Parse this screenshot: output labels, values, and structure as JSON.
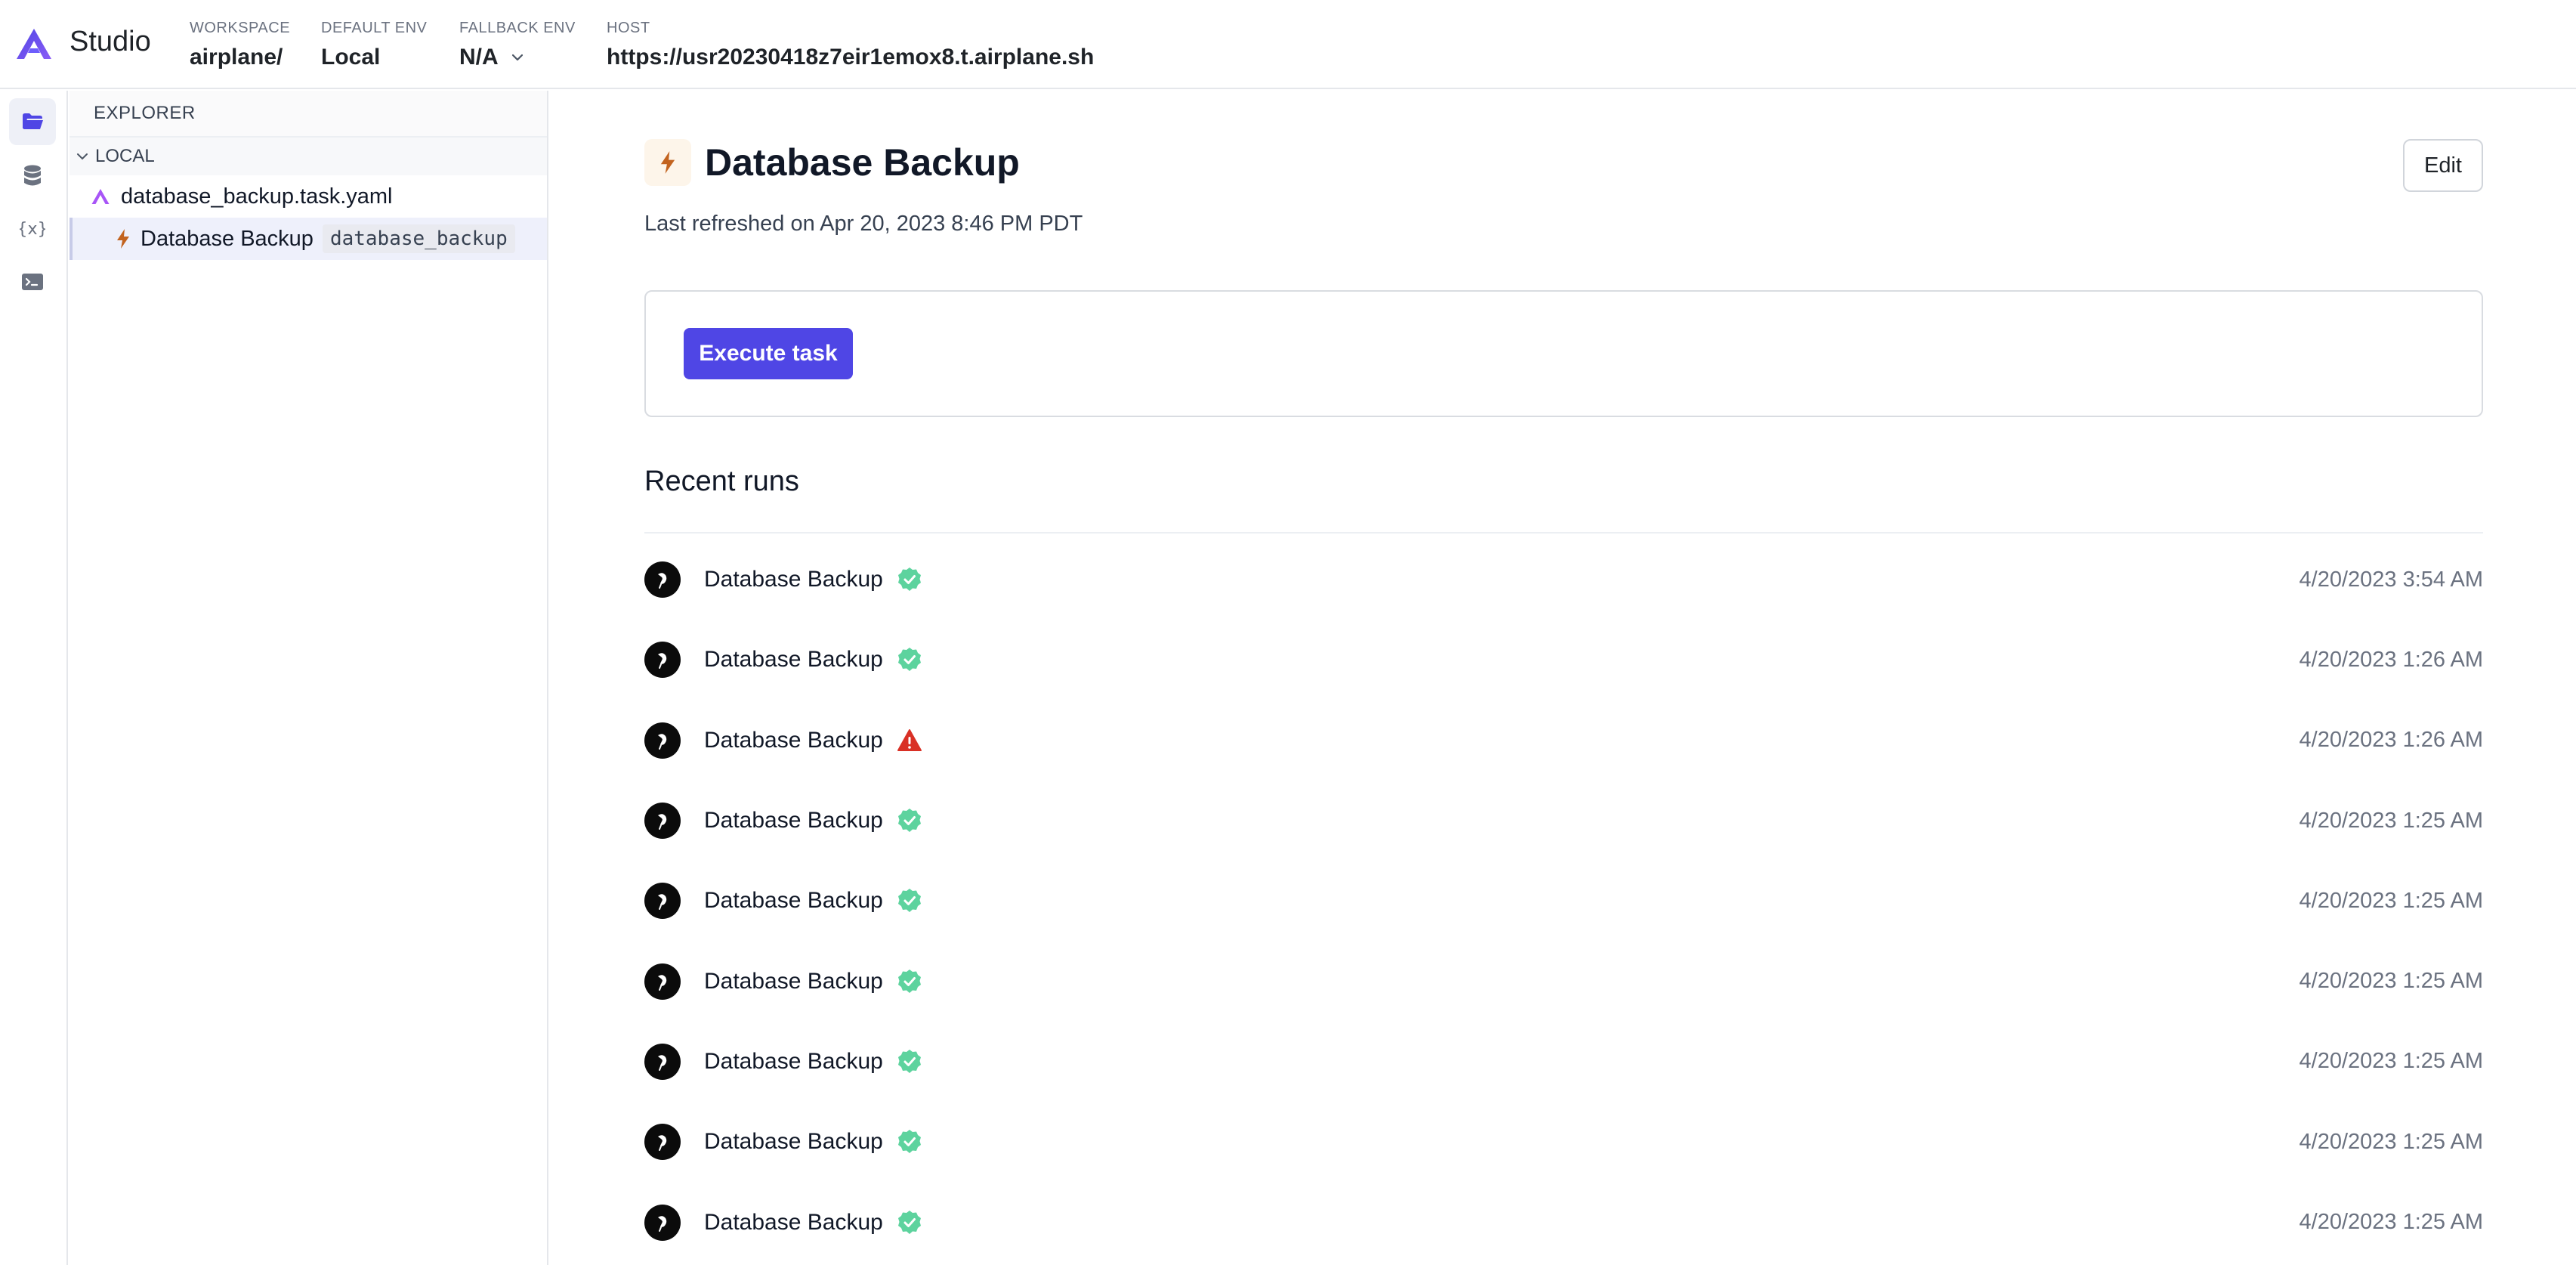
{
  "header": {
    "brand": "Studio",
    "workspace": {
      "label": "WORKSPACE",
      "value": "airplane/"
    },
    "default_env": {
      "label": "DEFAULT ENV",
      "value": "Local"
    },
    "fallback_env": {
      "label": "FALLBACK ENV",
      "value": "N/A"
    },
    "host": {
      "label": "HOST",
      "value": "https://usr20230418z7eir1emox8.t.airplane.sh"
    }
  },
  "activity_bar": {
    "items": [
      {
        "icon": "folder-icon",
        "active": true
      },
      {
        "icon": "database-icon",
        "active": false
      },
      {
        "icon": "variables-icon",
        "active": false
      },
      {
        "icon": "terminal-icon",
        "active": false
      }
    ]
  },
  "explorer": {
    "title": "EXPLORER",
    "section": "LOCAL",
    "file": "database_backup.task.yaml",
    "task": {
      "name": "Database Backup",
      "slug": "database_backup"
    }
  },
  "main": {
    "title": "Database Backup",
    "edit_label": "Edit",
    "last_refreshed": "Last refreshed on Apr 20, 2023 8:46 PM PDT",
    "execute_label": "Execute task",
    "recent_runs_title": "Recent runs",
    "runs": [
      {
        "name": "Database Backup",
        "status": "success",
        "time": "4/20/2023 3:54 AM"
      },
      {
        "name": "Database Backup",
        "status": "success",
        "time": "4/20/2023 1:26 AM"
      },
      {
        "name": "Database Backup",
        "status": "failed",
        "time": "4/20/2023 1:26 AM"
      },
      {
        "name": "Database Backup",
        "status": "success",
        "time": "4/20/2023 1:25 AM"
      },
      {
        "name": "Database Backup",
        "status": "success",
        "time": "4/20/2023 1:25 AM"
      },
      {
        "name": "Database Backup",
        "status": "success",
        "time": "4/20/2023 1:25 AM"
      },
      {
        "name": "Database Backup",
        "status": "success",
        "time": "4/20/2023 1:25 AM"
      },
      {
        "name": "Database Backup",
        "status": "success",
        "time": "4/20/2023 1:25 AM"
      },
      {
        "name": "Database Backup",
        "status": "success",
        "time": "4/20/2023 1:25 AM"
      }
    ]
  },
  "colors": {
    "accent": "#4f46e5",
    "success": "#5dd39e",
    "failed": "#d93025",
    "task_icon": "#c2631f"
  }
}
